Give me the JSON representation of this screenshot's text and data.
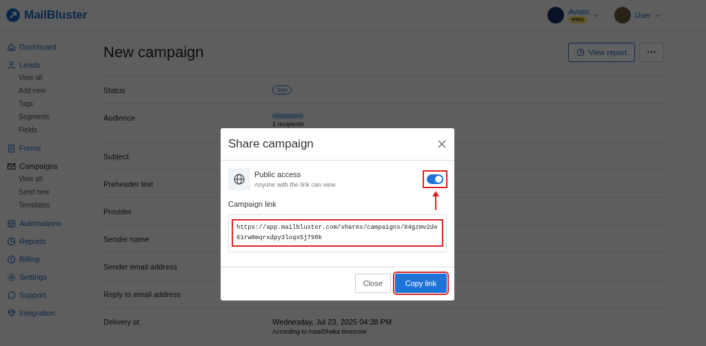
{
  "brand": "MailBluster",
  "header": {
    "workspace": {
      "name": "Aviato",
      "badge": "PRO"
    },
    "user": {
      "name": "User"
    }
  },
  "sidebar": {
    "items": [
      {
        "label": "Dashboard",
        "selected": false
      },
      {
        "label": "Leads",
        "selected": false,
        "children": [
          {
            "label": "View all"
          },
          {
            "label": "Add new"
          },
          {
            "label": "Tags"
          },
          {
            "label": "Segments"
          },
          {
            "label": "Fields"
          }
        ]
      },
      {
        "label": "Forms",
        "selected": false
      },
      {
        "label": "Campaigns",
        "selected": true,
        "children": [
          {
            "label": "View all"
          },
          {
            "label": "Send new"
          },
          {
            "label": "Templates"
          }
        ]
      },
      {
        "label": "Automations",
        "selected": false
      },
      {
        "label": "Reports",
        "selected": false
      },
      {
        "label": "Billing",
        "selected": false
      },
      {
        "label": "Settings",
        "selected": false
      },
      {
        "label": "Support",
        "selected": false
      },
      {
        "label": "Integration",
        "selected": false
      }
    ]
  },
  "page": {
    "title": "New campaign",
    "actions": {
      "view_report": "View report"
    },
    "details": [
      {
        "label": "Status",
        "kind": "badge",
        "value": "Sent"
      },
      {
        "label": "Audience",
        "kind": "blurred",
        "note": "2 recipients"
      },
      {
        "label": "Subject",
        "kind": "none"
      },
      {
        "label": "Preheader text",
        "kind": "none"
      },
      {
        "label": "Provider",
        "kind": "none"
      },
      {
        "label": "Sender name",
        "kind": "none"
      },
      {
        "label": "Sender email address",
        "kind": "none"
      },
      {
        "label": "Reply to email address",
        "kind": "none"
      },
      {
        "label": "Delivery at",
        "kind": "text",
        "value": "Wednesday, Jul 23, 2025 04:38 PM",
        "note": "According to Asia/Dhaka timezone"
      }
    ]
  },
  "modal": {
    "title": "Share campaign",
    "access": {
      "title": "Public access",
      "description": "Anyone with the link can view",
      "on": true,
      "highlighted": true
    },
    "link_label": "Campaign link",
    "link": {
      "value": "https://app.mailbluster.com/shares/campaigns/84gzmv2de61rw0mqrxdpy3loqx5j790k",
      "highlighted": true
    },
    "buttons": [
      {
        "label": "Close",
        "kind": "secondary",
        "highlighted": false
      },
      {
        "label": "Copy link",
        "kind": "primary",
        "highlighted": true
      }
    ]
  }
}
